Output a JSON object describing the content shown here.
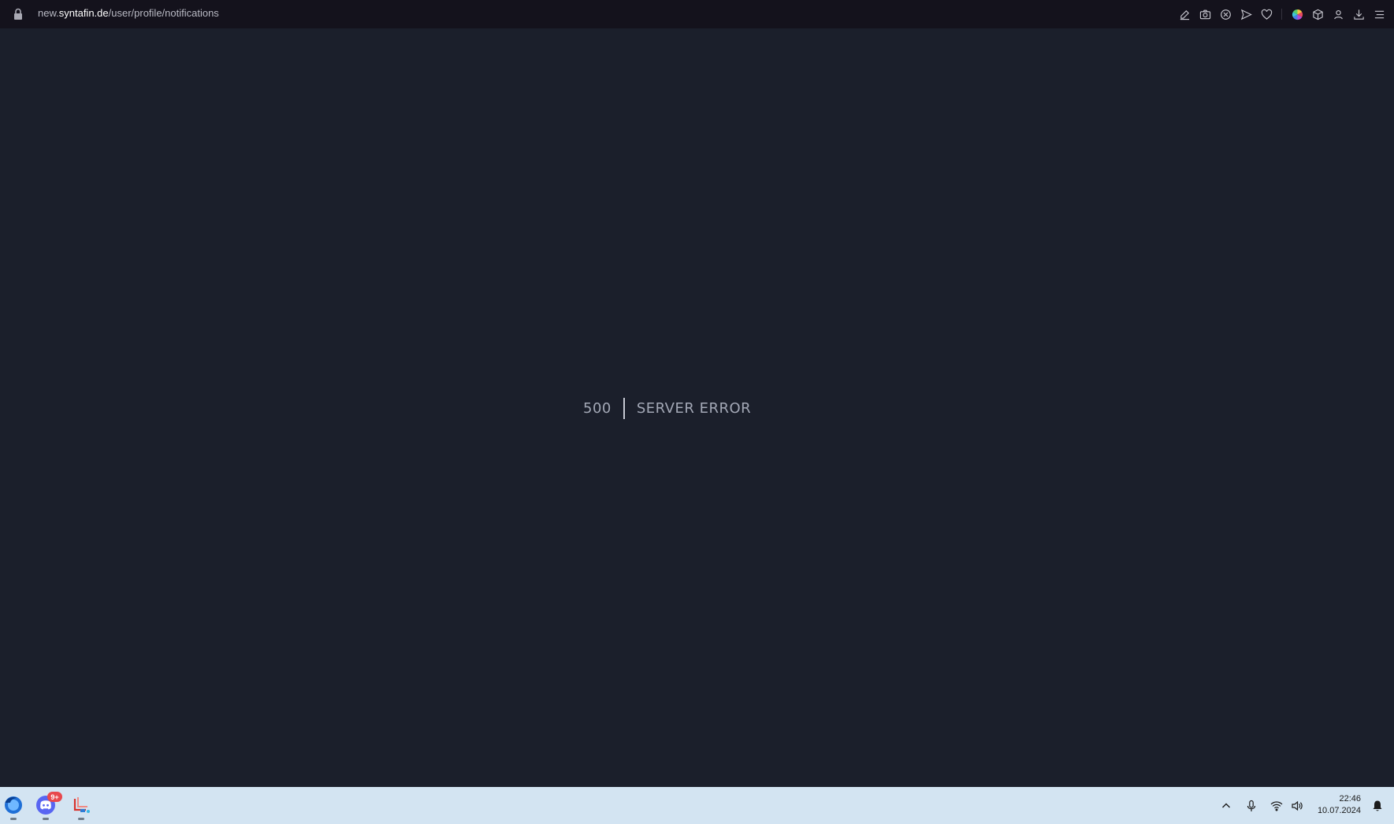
{
  "browser": {
    "url_prefix": "new.",
    "url_host": "syntafin.de",
    "url_path": "/user/profile/notifications",
    "toolbar_icons": [
      "edit-icon",
      "camera-icon",
      "block-icon",
      "send-icon",
      "heart-icon",
      "color-wheel-icon",
      "cube-icon",
      "profile-icon",
      "download-icon",
      "menu-icon"
    ]
  },
  "page": {
    "error_code": "500",
    "error_message": "SERVER ERROR"
  },
  "taskbar": {
    "apps": [
      "firefox-icon",
      "discord-icon",
      "snipping-tool-icon"
    ],
    "discord_badge": "9+",
    "tray_icons": [
      "chevron-up-icon",
      "microphone-icon",
      "wifi-icon",
      "speaker-icon",
      "bell-icon"
    ],
    "time": "22:46",
    "date": "10.07.2024"
  },
  "colors": {
    "page_background": "#1b1f2b",
    "addressbar_background": "#14121c",
    "taskbar_background": "#d3e4f2",
    "error_text": "#a3a8b6",
    "badge": "#e8484d"
  }
}
